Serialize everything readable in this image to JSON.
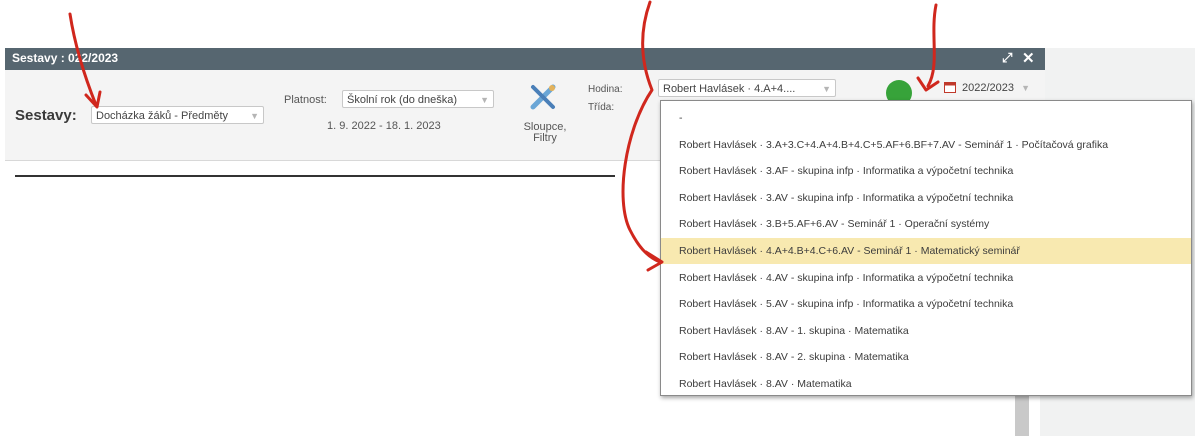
{
  "window": {
    "title": "Sestavy : 022/2023",
    "expand_icon": "expand-icon",
    "close_icon": "close-icon"
  },
  "toolbar": {
    "sestavy_label": "Sestavy:",
    "sestavy_value": "Docházka žáků - Předměty",
    "platnost_label": "Platnost:",
    "platnost_value": "Školní rok (do dneška)",
    "date_range": "1. 9. 2022 - 18. 1. 2023",
    "sloupce_label_line1": "Sloupce,",
    "sloupce_label_line2": "Filtry",
    "hodina_label": "Hodina:",
    "trida_label": "Třída:",
    "hodina_value": "Robert Havlásek · 4.A+4....",
    "year_value": "2022/2023"
  },
  "dropdown": {
    "options": [
      {
        "label": "-"
      },
      {
        "label": "Robert Havlásek · 3.A+3.C+4.A+4.B+4.C+5.AF+6.BF+7.AV - Seminář 1 · Počítačová grafika"
      },
      {
        "label": "Robert Havlásek · 3.AF - skupina infp · Informatika a výpočetní technika"
      },
      {
        "label": "Robert Havlásek · 3.AV - skupina infp · Informatika a výpočetní technika"
      },
      {
        "label": "Robert Havlásek · 3.B+5.AF+6.AV - Seminář 1 · Operační systémy"
      },
      {
        "label": "Robert Havlásek · 4.A+4.B+4.C+6.AV - Seminář 1 · Matematický seminář"
      },
      {
        "label": "Robert Havlásek · 4.AV - skupina infp · Informatika a výpočetní technika"
      },
      {
        "label": "Robert Havlásek · 5.AV - skupina infp · Informatika a výpočetní technika"
      },
      {
        "label": "Robert Havlásek · 8.AV - 1. skupina · Matematika"
      },
      {
        "label": "Robert Havlásek · 8.AV - 2. skupina · Matematika"
      },
      {
        "label": "Robert Havlásek · 8.AV · Matematika"
      }
    ],
    "selected_index": 5
  },
  "colors": {
    "titlebar": "#566670",
    "highlight": "#f8e9b0",
    "annotation": "#d0271d"
  }
}
